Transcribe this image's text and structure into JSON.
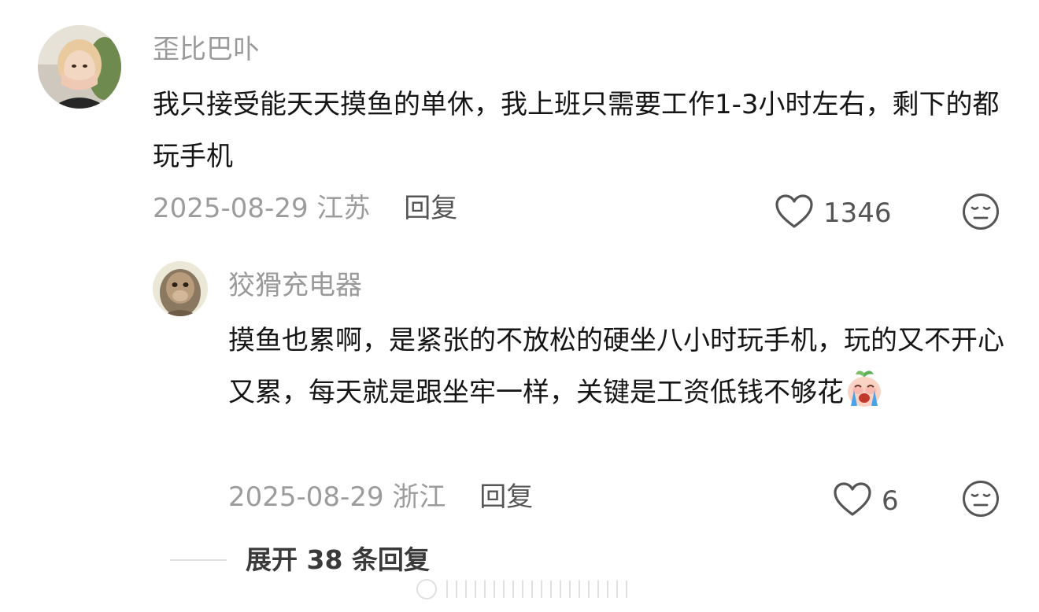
{
  "comments": [
    {
      "username": "歪比巴卟",
      "text": "我只接受能天天摸鱼的单休，我上班只需要工作1-3小时左右，剩下的都玩手机",
      "date": "2025-08-29",
      "location": "江苏",
      "reply_label": "回复",
      "likes": "1346",
      "avatar_icon": "avatar-girl-photo"
    },
    {
      "username": "狡猾充电器",
      "text": "摸鱼也累啊，是紧张的不放松的硬坐八小时玩手机，玩的又不开心又累，每天就是跟坐牢一样，关键是工资低钱不够花",
      "date": "2025-08-29",
      "location": "浙江",
      "reply_label": "回复",
      "likes": "6",
      "avatar_icon": "avatar-monkey-photo",
      "trailing_emoji": "crying-peach-emoji"
    }
  ],
  "expand": {
    "label": "展开 38 条回复"
  },
  "colors": {
    "username": "#9a9a9a",
    "text": "#161616",
    "meta": "#9c9c9c",
    "action": "#555555"
  }
}
